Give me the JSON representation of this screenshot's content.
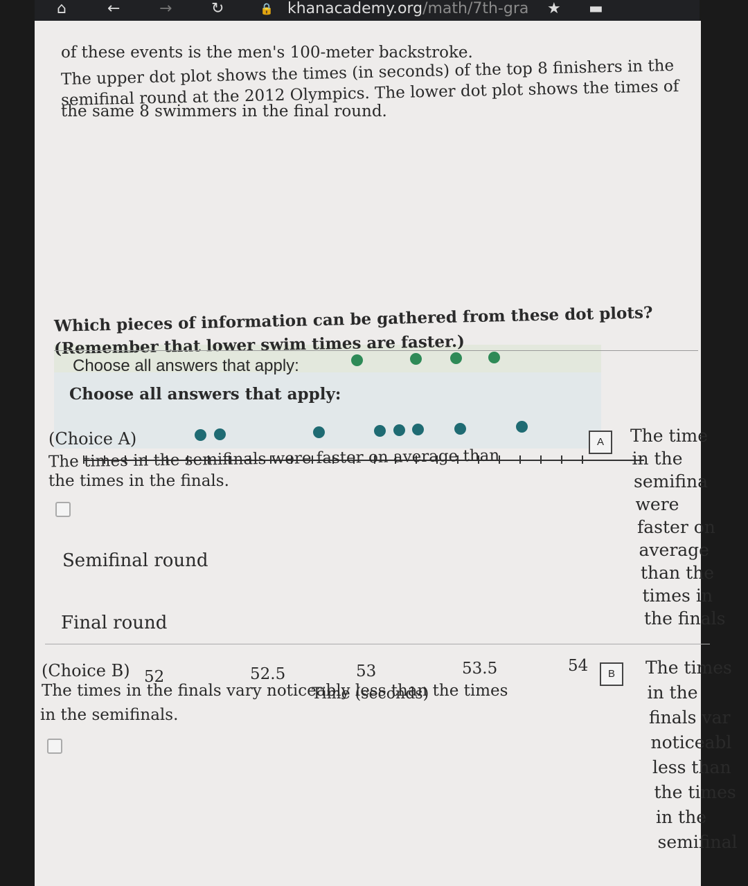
{
  "browser": {
    "url_host": "khanacademy.org",
    "url_path": "/math/7th-gra",
    "icons": [
      "home-icon",
      "back-icon",
      "forward-icon",
      "reload-icon",
      "lock-icon",
      "star-icon",
      "menu-icon"
    ]
  },
  "intro": [
    "of these events is the men's 100-meter backstroke.",
    "The upper dot plot shows the times (in seconds) of the top 8 finishers in the",
    "semifinal round at the 2012 Olympics. The lower dot plot shows the times of",
    "the same 8 swimmers in the final round."
  ],
  "question": [
    "Which pieces of information can be gathered from these dot plots?",
    "(Remember that lower swim times are faster.)"
  ],
  "instruction": "Choose all answers that apply:",
  "plot": {
    "rows": [
      "Semifinal round",
      "Final round"
    ],
    "ticks": [
      "52",
      "52.5",
      "53",
      "53.5",
      "54"
    ],
    "xlabel": "Time (seconds)",
    "upper_dots": [
      52.95,
      53.23,
      53.42,
      53.6
    ],
    "lower_dots": [
      52.21,
      52.3,
      52.77,
      53.06,
      53.15,
      53.24,
      53.44,
      53.73
    ],
    "colors": {
      "upper": "#2e8a57",
      "lower": "#1f6b73"
    }
  },
  "choices": [
    {
      "label": "(Choice A)",
      "text1": "The times in the semifinals were faster on average than",
      "text2": "the times in the finals.",
      "badge": "A",
      "side": [
        "The time",
        "in the",
        "semifina",
        "were",
        "faster on",
        "average",
        "than the",
        "times in",
        "the finals"
      ]
    },
    {
      "label": "(Choice B)",
      "text1": "The times in the finals vary noticeably less than the times",
      "text2": "in the semifinals.",
      "badge": "B",
      "side": [
        "The times",
        "in the",
        "finals var",
        "noticeabl",
        "less than",
        "the times",
        "in the",
        "semifinal"
      ]
    }
  ]
}
